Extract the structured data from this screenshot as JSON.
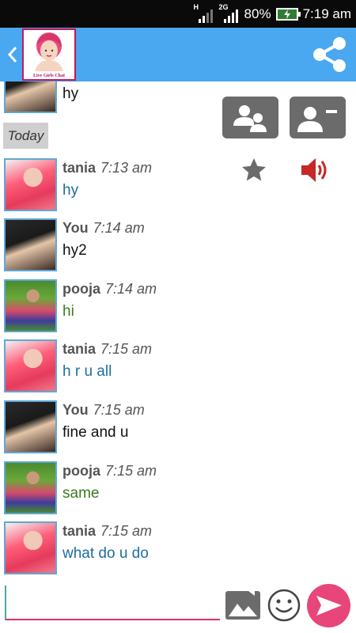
{
  "status_bar": {
    "network_h": "H",
    "network_2g": "2G",
    "battery_percent": "80%",
    "time": "7:19 am"
  },
  "app_bar": {
    "logo_caption": "Live Girls Chat",
    "icons": [
      "back-icon",
      "share-icon"
    ]
  },
  "colors": {
    "app_bar": "#4aa8f0",
    "tania_text": "#1e6e9e",
    "pooja_text": "#3c7a1c",
    "you_text": "#111111",
    "send_button": "#e8467a",
    "speaker_icon": "#c62828"
  },
  "chat": {
    "previous_text": "hy",
    "date_divider": "Today",
    "messages": [
      {
        "name": "tania",
        "time": "7:13 am",
        "text": "hy",
        "avatar": "tania-avatar"
      },
      {
        "name": "You",
        "time": "7:14 am",
        "text": "hy2",
        "avatar": "you-avatar"
      },
      {
        "name": "pooja",
        "time": "7:14 am",
        "text": "hi",
        "avatar": "pooja-avatar"
      },
      {
        "name": "tania",
        "time": "7:15 am",
        "text": "h r u all",
        "avatar": "tania-avatar"
      },
      {
        "name": "You",
        "time": "7:15 am",
        "text": "fine and u",
        "avatar": "you-avatar"
      },
      {
        "name": "pooja",
        "time": "7:15 am",
        "text": "same",
        "avatar": "pooja-avatar"
      },
      {
        "name": "tania",
        "time": "7:15 am",
        "text": "what do u do",
        "avatar": "tania-avatar"
      }
    ]
  },
  "actions": {
    "icons": [
      "group-icon",
      "remove-contact-icon",
      "star-icon",
      "speaker-icon"
    ]
  },
  "composer": {
    "input_value": "",
    "input_placeholder": "",
    "icons": [
      "gallery-icon",
      "emoji-icon",
      "send-icon"
    ]
  }
}
